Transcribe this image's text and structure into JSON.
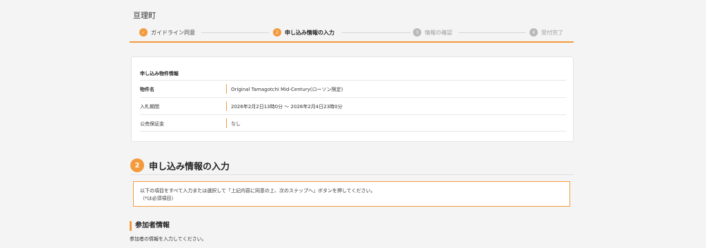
{
  "header": {
    "city": "亘理町"
  },
  "steps": [
    {
      "num": "✓",
      "label": "ガイドライン同意",
      "state": "done"
    },
    {
      "num": "2",
      "label": "申し込み情報の入力",
      "state": "active"
    },
    {
      "num": "3",
      "label": "情報の確認",
      "state": "todo"
    },
    {
      "num": "4",
      "label": "受付完了",
      "state": "todo"
    }
  ],
  "property": {
    "title": "申し込み物件情報",
    "rows": [
      {
        "key": "物件名",
        "value": "Original Tamagotchi Mid-Century(ローソン限定)"
      },
      {
        "key": "入札期間",
        "value": "2026年2月2日13時0分 〜 2026年2月4日23時0分"
      },
      {
        "key": "公売保証金",
        "value": "なし"
      }
    ]
  },
  "section": {
    "num": "2",
    "title": "申し込み情報の入力"
  },
  "notice": {
    "line1": "以下の項目をすべて入力または選択して「上記内容に同意の上、次のステップへ」ボタンを押してください。",
    "line2": "（*は必須項目）"
  },
  "participant": {
    "title": "参加者情報",
    "desc": "参加者の情報を入力してください。"
  },
  "colors": {
    "accent": "#f39a3c",
    "inactive": "#b9b9b9"
  }
}
